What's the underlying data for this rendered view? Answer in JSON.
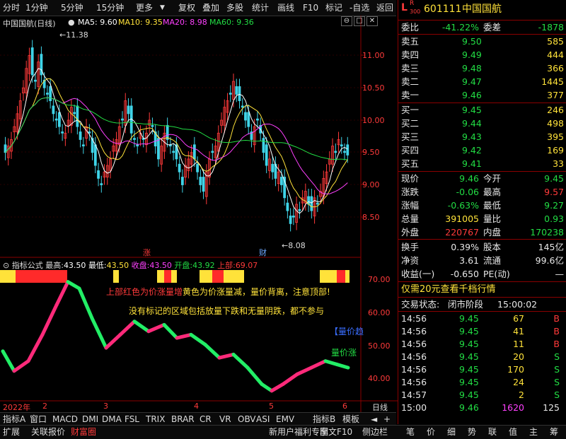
{
  "toolbar": {
    "items": [
      "分时",
      "1分钟",
      "5分钟",
      "15分钟",
      "更多",
      "复权",
      "叠加",
      "多股",
      "统计",
      "画线",
      "F10",
      "标记",
      "-自选",
      "返回"
    ]
  },
  "main_chart": {
    "title": "中国国航(日线)",
    "ma": [
      {
        "label": "MA5: 9.60",
        "color": "#ffffff"
      },
      {
        "label": "MA10: 9.35",
        "color": "#ffe23a"
      },
      {
        "label": "MA20: 8.98",
        "color": "#ff40ff"
      },
      {
        "label": "MA60: 9.36",
        "color": "#22dd44"
      }
    ],
    "y_ticks": [
      "11.00",
      "10.50",
      "10.00",
      "9.50",
      "9.00",
      "8.50"
    ],
    "high_label": "11.38",
    "low_label": "8.08",
    "marker_up": "涨",
    "marker_fin": "财"
  },
  "indicator": {
    "title": "指标公式",
    "high_label": "最高:",
    "high": "43.50",
    "low_label": "最低:",
    "low": "43.50",
    "close_label": "收盘:",
    "close": "43.50",
    "open_label": "开盘:",
    "open": "43.92",
    "top_label": "上部:",
    "top": "69.07",
    "y_ticks": [
      "70.00",
      "60.00",
      "50.00",
      "40.00"
    ],
    "note1_red": "上部红色为价涨量增",
    "note1_yel": "黄色为价涨量减，量价背离，注意顶部!",
    "note2": "没有标记的区域包括放量下跌和无量阴跌，都不参与",
    "tag1": "【量价趋",
    "tag2": "量价涨"
  },
  "x_axis": {
    "labels": [
      "2022年",
      "2",
      "3",
      "4",
      "5",
      "6"
    ],
    "period": "日线"
  },
  "panel": {
    "logo_l": "L",
    "logo_r": "R",
    "logo_n": "300",
    "code": "601111",
    "name": "中国国航",
    "wb_label": "委比",
    "wb": "-41.22%",
    "wc_label": "委差",
    "wc": "-1878",
    "asks": [
      {
        "n": "卖五",
        "p": "9.50",
        "v": "585"
      },
      {
        "n": "卖四",
        "p": "9.49",
        "v": "444"
      },
      {
        "n": "卖三",
        "p": "9.48",
        "v": "366"
      },
      {
        "n": "卖二",
        "p": "9.47",
        "v": "1445"
      },
      {
        "n": "卖一",
        "p": "9.46",
        "v": "377"
      }
    ],
    "bids": [
      {
        "n": "买一",
        "p": "9.45",
        "v": "246"
      },
      {
        "n": "买二",
        "p": "9.44",
        "v": "498"
      },
      {
        "n": "买三",
        "p": "9.43",
        "v": "395"
      },
      {
        "n": "买四",
        "p": "9.42",
        "v": "169"
      },
      {
        "n": "买五",
        "p": "9.41",
        "v": "33"
      }
    ],
    "quote": [
      {
        "a": "现价",
        "av": "9.46",
        "ac": "grn",
        "b": "今开",
        "bv": "9.45",
        "bc": "grn"
      },
      {
        "a": "涨跌",
        "av": "-0.06",
        "ac": "grn",
        "b": "最高",
        "bv": "9.57",
        "bc": "red"
      },
      {
        "a": "涨幅",
        "av": "-0.63%",
        "ac": "grn",
        "b": "最低",
        "bv": "9.27",
        "bc": "grn"
      },
      {
        "a": "总量",
        "av": "391005",
        "ac": "yel",
        "b": "量比",
        "bv": "0.93",
        "bc": "grn"
      },
      {
        "a": "外盘",
        "av": "220767",
        "ac": "red",
        "b": "内盘",
        "bv": "170238",
        "bc": "grn"
      }
    ],
    "stats": [
      {
        "a": "换手",
        "av": "0.39%",
        "b": "股本",
        "bv": "145亿"
      },
      {
        "a": "净资",
        "av": "3.61",
        "b": "流通",
        "bv": "99.6亿"
      },
      {
        "a": "收益(一)",
        "av": "-0.650",
        "b": "PE(动)",
        "bv": "—"
      }
    ],
    "ad": "仅需20元查看千档行情",
    "status_label": "交易状态:",
    "status": "闭市阶段",
    "status_time": "15:00:02",
    "ticks": [
      {
        "t": "14:56",
        "p": "9.45",
        "v": "67",
        "s": "B"
      },
      {
        "t": "14:56",
        "p": "9.45",
        "v": "41",
        "s": "B"
      },
      {
        "t": "14:56",
        "p": "9.45",
        "v": "11",
        "s": "B"
      },
      {
        "t": "14:56",
        "p": "9.45",
        "v": "20",
        "s": "S"
      },
      {
        "t": "14:56",
        "p": "9.45",
        "v": "170",
        "s": "S"
      },
      {
        "t": "14:56",
        "p": "9.45",
        "v": "24",
        "s": "S"
      },
      {
        "t": "14:57",
        "p": "9.45",
        "v": "2",
        "s": "S"
      },
      {
        "t": "15:00",
        "p": "9.46",
        "v": "1620",
        "s": "125"
      }
    ]
  },
  "tabs_top": [
    "指标A",
    "窗口",
    "MACD",
    "DMI",
    "DMA",
    "FSL",
    "TRIX",
    "BRAR",
    "CR",
    "VR",
    "OBV",
    "ASI",
    "EMV",
    "指标B",
    "模板"
  ],
  "tabs_bottom": [
    "扩展",
    "关联报价",
    "财富圈",
    "新用户福利专享",
    "图文F10",
    "侧边栏"
  ],
  "side_tabs": [
    "笔",
    "价",
    "细",
    "势",
    "联",
    "值",
    "主",
    "筹"
  ],
  "colors": {
    "up": "#ff3a3a",
    "down": "#22dd44",
    "ma10": "#ffe23a",
    "ma20": "#ff40ff",
    "grid": "#8a0000"
  }
}
